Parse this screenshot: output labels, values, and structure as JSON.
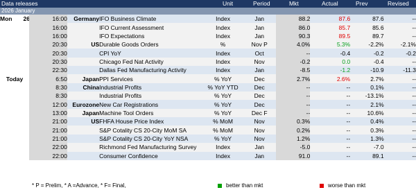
{
  "header": {
    "title": "Data releases",
    "columns": {
      "unit": "Unit",
      "period": "Period",
      "mkt": "Mkt",
      "actual": "Actual",
      "prev": "Prev",
      "revised": "Revised"
    }
  },
  "subheader": "2026 January",
  "day": {
    "weekday": "Mon",
    "date": "26",
    "today": "Today"
  },
  "rows": [
    {
      "time": "16:00",
      "country": "Germany",
      "event": "IFO Business Climate",
      "unit": "Index",
      "period": "Jan",
      "mkt": "88.2",
      "actual": "87.6",
      "actual_color": "red",
      "prev": "87.6",
      "revised": "--"
    },
    {
      "time": "16:00",
      "country": "",
      "event": "IFO Current Assessment",
      "unit": "Index",
      "period": "Jan",
      "mkt": "86.0",
      "actual": "85.7",
      "actual_color": "red",
      "prev": "85.6",
      "revised": "--"
    },
    {
      "time": "16:00",
      "country": "",
      "event": "IFO Expectations",
      "unit": "Index",
      "period": "Jan",
      "mkt": "90.3",
      "actual": "89.5",
      "actual_color": "red",
      "prev": "89.7",
      "revised": "--"
    },
    {
      "time": "20:30",
      "country": "US",
      "event": "Durable Goods Orders",
      "unit": "%",
      "period": "Nov P",
      "mkt": "4.0%",
      "actual": "5.3%",
      "actual_color": "green",
      "prev": "-2.2%",
      "revised": "-2.1%"
    },
    {
      "time": "20:30",
      "country": "",
      "event": "CPI YoY",
      "unit": "Index",
      "period": "Oct",
      "mkt": "--",
      "actual": "-0.4",
      "actual_color": "",
      "prev": "-0.2",
      "revised": "-0.2"
    },
    {
      "time": "20:30",
      "country": "",
      "event": "Chicago Fed Nat Activity",
      "unit": "Index",
      "period": "Nov",
      "mkt": "-0.2",
      "actual": "0.0",
      "actual_color": "green",
      "prev": "-0.4",
      "revised": "--"
    },
    {
      "time": "22:30",
      "country": "",
      "event": "Dallas Fed Manufacturing Activity",
      "unit": "Index",
      "period": "Jan",
      "mkt": "-8.5",
      "actual": "-1.2",
      "actual_color": "green",
      "prev": "-10.9",
      "revised": "-11.3"
    },
    {
      "time": "6:50",
      "country": "Japan",
      "event": "PPI Services",
      "unit": "% YoY",
      "period": "Dec",
      "mkt": "2.7%",
      "actual": "2.6%",
      "actual_color": "red",
      "prev": "2.7%",
      "revised": "--"
    },
    {
      "time": "8:30",
      "country": "China",
      "event": "Industrial Profits",
      "unit": "% YoY YTD",
      "period": "Dec",
      "mkt": "--",
      "actual": "--",
      "actual_color": "",
      "prev": "0.1%",
      "revised": "--"
    },
    {
      "time": "8:30",
      "country": "",
      "event": "Industrial Profits",
      "unit": "% YoY",
      "period": "Dec",
      "mkt": "--",
      "actual": "--",
      "actual_color": "",
      "prev": "-13.1%",
      "revised": "--"
    },
    {
      "time": "12:00",
      "country": "Eurozone",
      "event": "New Car Registrations",
      "unit": "% YoY",
      "period": "Dec",
      "mkt": "--",
      "actual": "--",
      "actual_color": "",
      "prev": "2.1%",
      "revised": "--"
    },
    {
      "time": "13:00",
      "country": "Japan",
      "event": "Machine Tool Orders",
      "unit": "% YoY",
      "period": "Dec F",
      "mkt": "--",
      "actual": "--",
      "actual_color": "",
      "prev": "10.6%",
      "revised": "--"
    },
    {
      "time": "21:00",
      "country": "US",
      "event": "FHFA House Price Index",
      "unit": "% MoM",
      "period": "Nov",
      "mkt": "0.3%",
      "actual": "--",
      "actual_color": "",
      "prev": "0.4%",
      "revised": "--"
    },
    {
      "time": "21:00",
      "country": "",
      "event": "S&P Cotality CS 20-City MoM SA",
      "unit": "% MoM",
      "period": "Nov",
      "mkt": "0.2%",
      "actual": "--",
      "actual_color": "",
      "prev": "0.3%",
      "revised": "--"
    },
    {
      "time": "21:00",
      "country": "",
      "event": "S&P Cotality CS 20-City YoY NSA",
      "unit": "% YoY",
      "period": "Nov",
      "mkt": "1.2%",
      "actual": "--",
      "actual_color": "",
      "prev": "1.3%",
      "revised": "--"
    },
    {
      "time": "22:00",
      "country": "",
      "event": "Richmond Fed Manufacturing Survey",
      "unit": "Index",
      "period": "Jan",
      "mkt": "-5.0",
      "actual": "--",
      "actual_color": "",
      "prev": "-7.0",
      "revised": "--"
    },
    {
      "time": "22:00",
      "country": "",
      "event": "Consumer Confidence",
      "unit": "Index",
      "period": "Jan",
      "mkt": "91.0",
      "actual": "--",
      "actual_color": "",
      "prev": "89.1",
      "revised": "--"
    }
  ],
  "footer": {
    "note": "* P = Prelim, * A =Advance, * F= Final,",
    "better": "better than mkt",
    "worse": "worse than mkt",
    "better_color": "#00a000",
    "worse_color": "#e00000"
  }
}
